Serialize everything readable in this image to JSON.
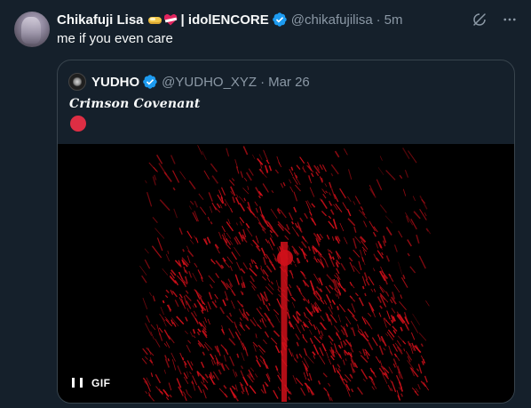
{
  "tweet": {
    "display_name": "Chikafuji Lisa",
    "name_suffix": "| idolENCORE",
    "handle": "@chikafujilisa",
    "separator": "·",
    "time": "5m",
    "text": "me if you even care",
    "emojis": [
      "handshake-emoji",
      "heart-bandage-emoji"
    ]
  },
  "quote": {
    "display_name": "YUDHO",
    "handle": "@YUDHO_XYZ",
    "separator": "·",
    "date": "Mar 26",
    "text": "Crimson Covenant",
    "emoji": "red-circle-emoji",
    "media": {
      "type": "gif",
      "label": "GIF"
    }
  },
  "colors": {
    "background": "#15202b",
    "text_primary": "#f7f9f9",
    "text_secondary": "#8b98a5",
    "border": "#38444d",
    "verified": "#1d9bf0",
    "red_circle": "#dd2e44",
    "art_red": "#d0101a"
  },
  "icons": {
    "grok": "grok-icon",
    "more": "more-icon",
    "verified": "verified-badge-icon",
    "pause": "pause-icon"
  }
}
